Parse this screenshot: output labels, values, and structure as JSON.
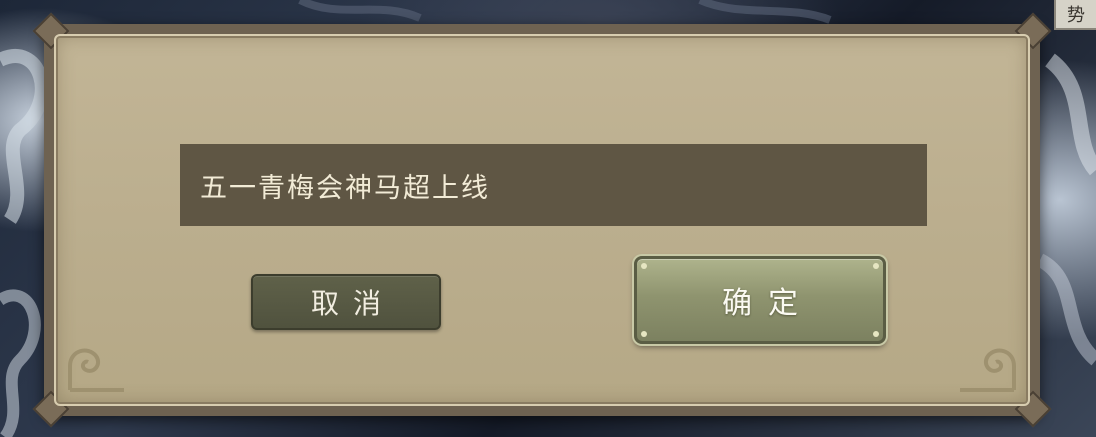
{
  "dialog": {
    "message": "五一青梅会神马超上线",
    "cancel_label": "取消",
    "confirm_label": "确定"
  },
  "background": {
    "corner_glyph": "势"
  },
  "colors": {
    "frame": "#6e6251",
    "panel": "#bbae8e",
    "message_bg": "#5f5644",
    "message_text": "#f2ebd6",
    "cancel_bg": "#55573f",
    "confirm_bg": "#8f946f"
  }
}
